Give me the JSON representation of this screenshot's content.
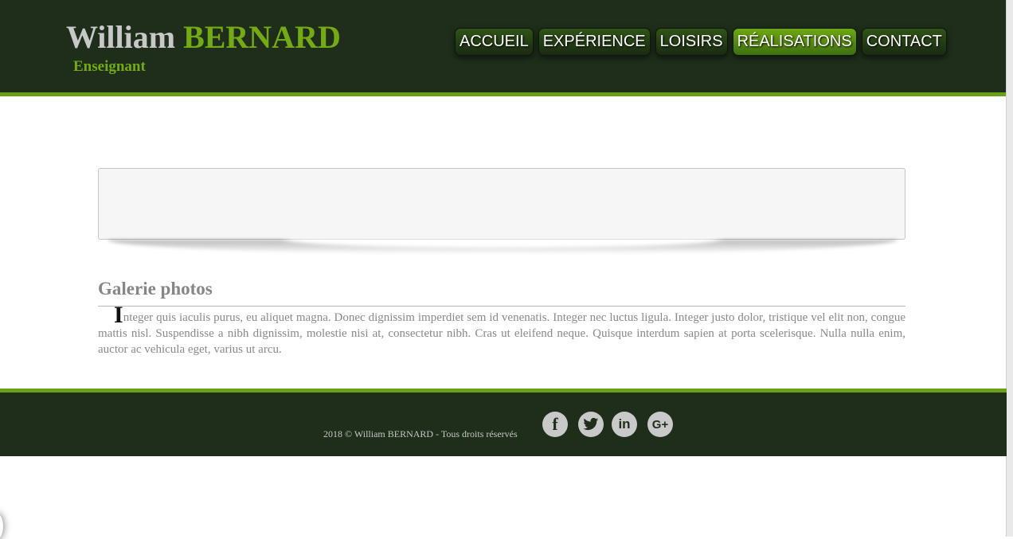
{
  "header": {
    "name_first": "William",
    "name_last": "BERNARD",
    "subtitle": "Enseignant"
  },
  "nav": {
    "items": [
      {
        "label": "ACCUEIL",
        "active": false
      },
      {
        "label": "EXPÉRIENCE",
        "active": false
      },
      {
        "label": "LOISIRS",
        "active": false
      },
      {
        "label": "RÉALISATIONS",
        "active": true
      },
      {
        "label": "CONTACT",
        "active": false
      }
    ]
  },
  "main": {
    "section_title": "Galerie photos",
    "dropcap": "I",
    "body": "nteger quis iaculis purus, eu aliquet magna. Donec dignissim imperdiet sem id venenatis. Integer nec luctus ligula. Integer justo dolor, tristique vel elit non, congue mattis nisl. Suspendisse a nibh dignissim, molestie nisi at, consectetur nibh. Cras ut eleifend neque. Quisque interdum sapien at porta scelerisque. Nulla nulla enim, auctor ac vehicula eget, varius ut arcu."
  },
  "footer": {
    "copyright": "2018 © William BERNARD - Tous droits réservés",
    "social": [
      {
        "icon": "facebook-icon",
        "glyph": "f"
      },
      {
        "icon": "twitter-icon",
        "glyph": "🐦"
      },
      {
        "icon": "linkedin-icon",
        "glyph": "in"
      },
      {
        "icon": "google-plus-icon",
        "glyph": "G+"
      }
    ]
  },
  "colors": {
    "dark_green": "#1f2e1b",
    "accent_green": "#6aa015",
    "brand_green": "#74ab14"
  }
}
